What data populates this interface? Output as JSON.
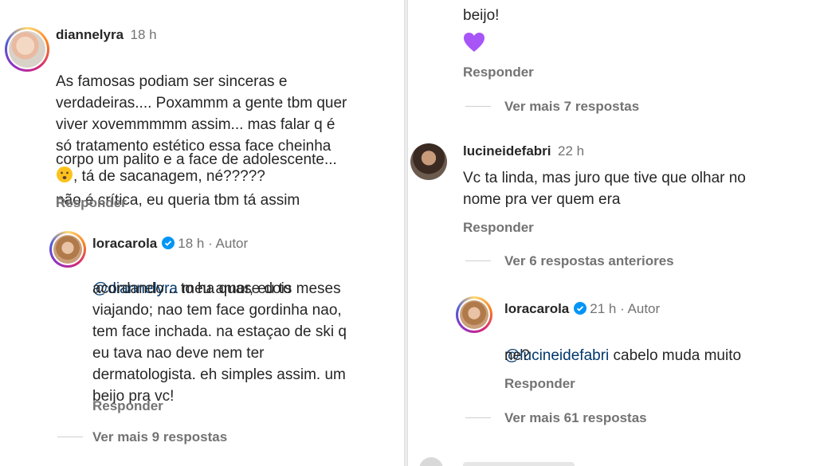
{
  "left": {
    "comment1": {
      "username": "diannelyra",
      "time": "18 h",
      "text_part1": "As famosas podiam ser sinceras e\nverdadeiras.... Poxammm a gente tbm quer\nviver xovemmmmm assim... mas falar q é\nsó tratamento estético essa face cheinha",
      "text_part2": ", tá de sacanagem, né?????",
      "text_part3": "corpo um palito e a face de adolescente...",
      "text_part4": "não é crítica, eu queria tbm tá assim",
      "reply_label": "Responder"
    },
    "reply1": {
      "username": "loracarola",
      "time": "18 h",
      "author_tag": "Autor",
      "mention": "@diannelyra",
      "text_first": " meu amor, eu to",
      "text_rest": "acordando... to ha quase dois meses\nviajando; nao tem face gordinha nao,\ntem face inchada. na estaçao de ski q\neu tava nao deve nem ter\ndermatologista. eh simples assim. um\nbeijo pra vc!",
      "reply_label": "Responder"
    },
    "view_more": "Ver mais 9 respostas"
  },
  "right": {
    "top_text": "beijo!",
    "top_reply_label": "Responder",
    "view_more_top": "Ver mais 7 respostas",
    "comment2": {
      "username": "lucineidefabri",
      "time": "22 h",
      "text": "Vc ta linda, mas juro que tive que olhar no\nnome pra ver quem era",
      "reply_label": "Responder"
    },
    "view_previous": "Ver 6 respostas anteriores",
    "reply2": {
      "username": "loracarola",
      "time": "21 h",
      "author_tag": "Autor",
      "mention": "@lucineidefabri",
      "text_first": " cabelo muda muito",
      "text_rest": "ne?",
      "reply_label": "Responder"
    },
    "view_more_bottom": "Ver mais 61 respostas"
  },
  "colors": {
    "text": "#262626",
    "muted": "#737373",
    "mention": "#00376b",
    "verified": "#0095f6",
    "heart": "#a855f7"
  }
}
